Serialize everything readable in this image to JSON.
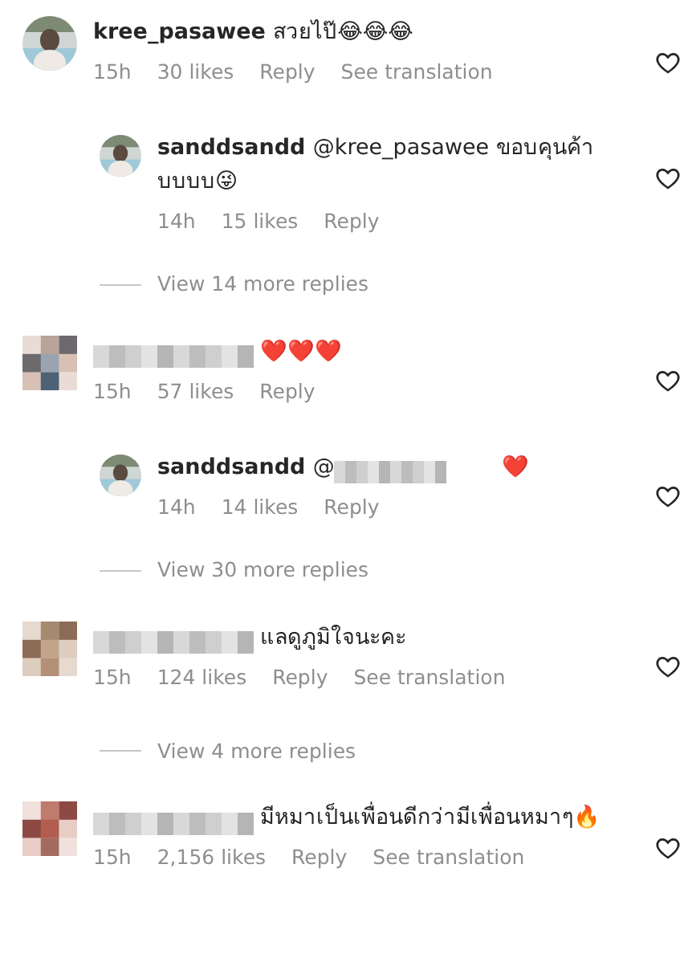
{
  "items": [
    {
      "kind": "comment",
      "avatar_pixelated": false,
      "username": "kree_pasawee",
      "text": "สวยไป๊😂😂😂",
      "time": "15h",
      "likes": "30 likes",
      "reply": "Reply",
      "translate": "See translation",
      "liked": false
    },
    {
      "kind": "reply",
      "avatar_pixelated": false,
      "username": "sanddsandd",
      "mention": "@kree_pasawee",
      "text": "ขอบคุนค้าบบบบ😜",
      "time": "14h",
      "likes": "15 likes",
      "reply": "Reply",
      "liked": false
    },
    {
      "kind": "view_more",
      "text": "View 14 more replies"
    },
    {
      "kind": "comment",
      "avatar_pixelated": true,
      "username_blurred": true,
      "text": "❤️❤️❤️",
      "time": "15h",
      "likes": "57 likes",
      "reply": "Reply",
      "liked": false
    },
    {
      "kind": "reply",
      "avatar_pixelated": false,
      "username": "sanddsandd",
      "mention": "@",
      "mention_blurred": true,
      "text": "❤️",
      "time": "14h",
      "likes": "14 likes",
      "reply": "Reply",
      "liked": false
    },
    {
      "kind": "view_more",
      "text": "View 30 more replies"
    },
    {
      "kind": "comment",
      "avatar_pixelated": true,
      "username_blurred": true,
      "text": "แลดูภูมิใจนะคะ",
      "time": "15h",
      "likes": "124 likes",
      "reply": "Reply",
      "translate": "See translation",
      "liked": false
    },
    {
      "kind": "view_more",
      "text": "View 4 more replies"
    },
    {
      "kind": "comment",
      "avatar_pixelated": true,
      "username_blurred": true,
      "text": "มีหมาเป็นเพื่อนดีกว่ามีเพื่อนหมาๆ🔥",
      "time": "15h",
      "likes": "2,156 likes",
      "reply": "Reply",
      "translate": "See translation",
      "liked": false
    }
  ]
}
